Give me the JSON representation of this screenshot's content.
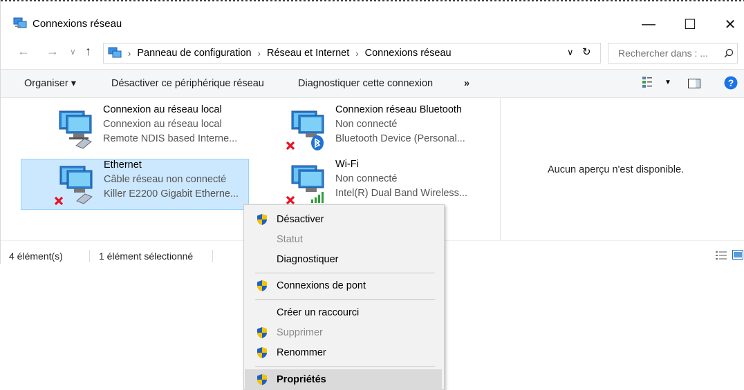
{
  "window": {
    "title": "Connexions réseau",
    "minimize_glyph": "—",
    "maximize_glyph": "☐",
    "close_glyph": "✕"
  },
  "address": {
    "back_glyph": "←",
    "forward_glyph": "→",
    "history_glyph": "∨",
    "up_glyph": "↑",
    "breadcrumbs": [
      "Panneau de configuration",
      "Réseau et Internet",
      "Connexions réseau"
    ],
    "dropdown_glyph": "∨",
    "refresh_glyph": "↻",
    "search_placeholder": "Rechercher dans : ..."
  },
  "toolbar": {
    "organize": "Organiser ▾",
    "disable_device": "Désactiver ce périphérique réseau",
    "diagnose": "Diagnostiquer cette connexion",
    "more": "»"
  },
  "connections": [
    {
      "name": "Connexion au réseau local",
      "status": "Connexion au réseau local",
      "device": "Remote NDIS based Interne...",
      "overlay": "none",
      "selected": false
    },
    {
      "name": "Connexion réseau Bluetooth",
      "status": "Non connecté",
      "device": "Bluetooth Device (Personal...",
      "overlay": "bluetooth-disconnected",
      "selected": false
    },
    {
      "name": "Ethernet",
      "status": "Câble réseau non connecté",
      "device": "Killer E2200 Gigabit Etherne...",
      "overlay": "cable-disconnected",
      "selected": true
    },
    {
      "name": "Wi-Fi",
      "status": "Non connecté",
      "device": "Intel(R) Dual Band Wireless...",
      "overlay": "wifi-disconnected",
      "selected": false
    }
  ],
  "preview": {
    "text": "Aucun aperçu n'est disponible."
  },
  "status": {
    "count": "4 élément(s)",
    "selection": "1 élément sélectionné"
  },
  "context_menu": [
    {
      "label": "Désactiver",
      "shield": true,
      "disabled": false,
      "bold": false
    },
    {
      "label": "Statut",
      "shield": false,
      "disabled": true,
      "bold": false
    },
    {
      "label": "Diagnostiquer",
      "shield": false,
      "disabled": false,
      "bold": false
    },
    {
      "label": "Connexions de pont",
      "shield": true,
      "disabled": false,
      "bold": false
    },
    {
      "label": "Créer un raccourci",
      "shield": false,
      "disabled": false,
      "bold": false
    },
    {
      "label": "Supprimer",
      "shield": true,
      "disabled": true,
      "bold": false
    },
    {
      "label": "Renommer",
      "shield": true,
      "disabled": false,
      "bold": false
    },
    {
      "label": "Propriétés",
      "shield": true,
      "disabled": false,
      "bold": true,
      "highlighted": true
    }
  ],
  "colors": {
    "accent": "#0078d7",
    "selection_bg": "#cce8ff",
    "selection_border": "#99d1ff",
    "error_red": "#e81123",
    "help_blue": "#1a73e8"
  }
}
